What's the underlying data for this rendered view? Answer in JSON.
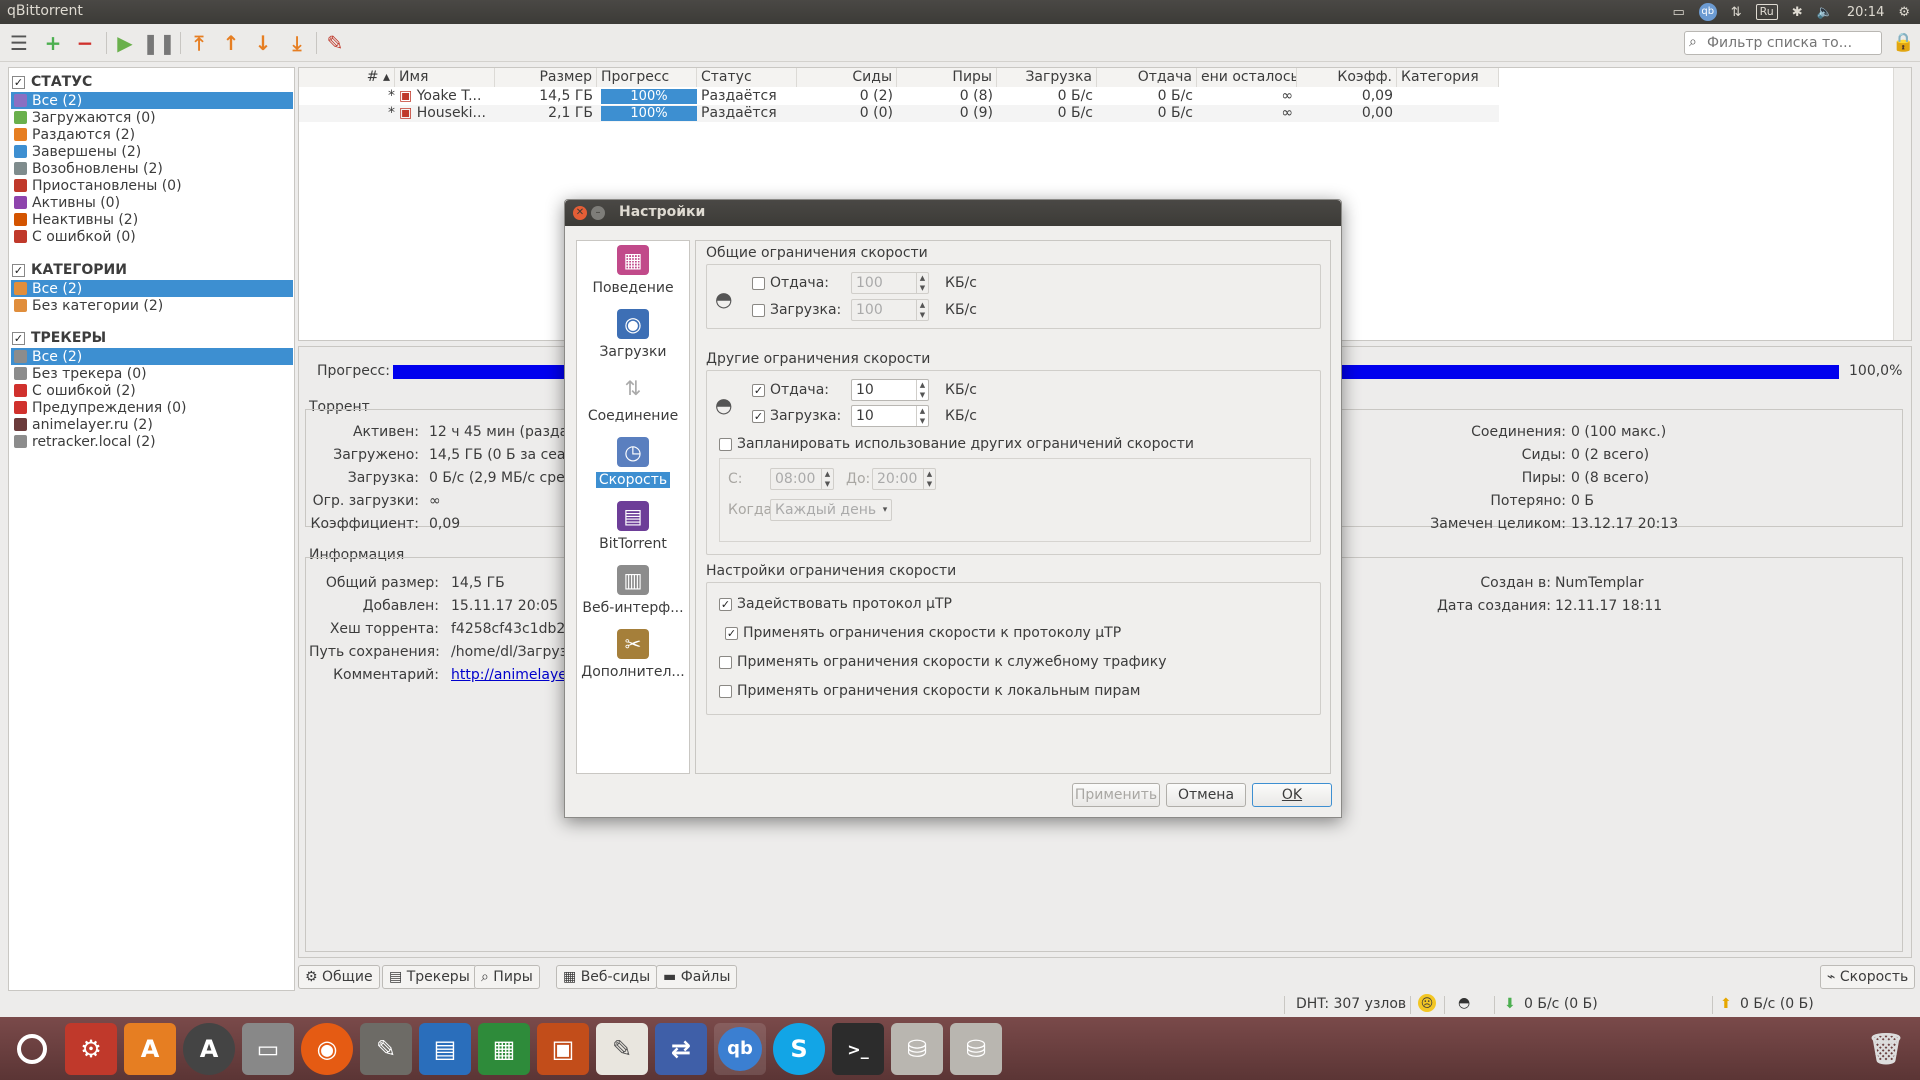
{
  "window": {
    "title": "qBittorrent"
  },
  "tray": {
    "lang": "Ru",
    "time": "20:14"
  },
  "toolbar": {
    "filter_placeholder": "Фильтр списка то..."
  },
  "sidebar": {
    "status": {
      "header": "СТАТУС",
      "items": [
        {
          "label": "Все (2)",
          "color": "#8a6fc2"
        },
        {
          "label": "Загружаются (0)",
          "color": "#6ab04c"
        },
        {
          "label": "Раздаются (2)",
          "color": "#e67e22"
        },
        {
          "label": "Завершены (2)",
          "color": "#3d8fd1"
        },
        {
          "label": "Возобновлены (2)",
          "color": "#7f8c8d"
        },
        {
          "label": "Приостановлены (0)",
          "color": "#c0392b"
        },
        {
          "label": "Активны (0)",
          "color": "#8e44ad"
        },
        {
          "label": "Неактивны (2)",
          "color": "#d35400"
        },
        {
          "label": "С ошибкой (0)",
          "color": "#c0392b"
        }
      ]
    },
    "categories": {
      "header": "КАТЕГОРИИ",
      "items": [
        {
          "label": "Все (2)",
          "color": "#e08e3c"
        },
        {
          "label": "Без категории (2)",
          "color": "#e08e3c"
        }
      ]
    },
    "trackers": {
      "header": "ТРЕКЕРЫ",
      "items": [
        {
          "label": "Все (2)",
          "color": "#8c8c8c"
        },
        {
          "label": "Без трекера (0)",
          "color": "#8c8c8c"
        },
        {
          "label": "С ошибкой (2)",
          "color": "#d0312d"
        },
        {
          "label": "Предупреждения (0)",
          "color": "#d0312d"
        },
        {
          "label": "animelayer.ru (2)",
          "color": "#6b3b3b"
        },
        {
          "label": "retracker.local (2)",
          "color": "#8c8c8c"
        }
      ]
    }
  },
  "table": {
    "headers": {
      "num": "#",
      "name": "Имя",
      "size": "Размер",
      "progress": "Прогресс",
      "status": "Статус",
      "seeds": "Сиды",
      "peers": "Пиры",
      "down": "Загрузка",
      "up": "Отдача",
      "eta": "ени осталось",
      "ratio": "Коэфф.",
      "category": "Категория"
    },
    "rows": [
      {
        "num": "*",
        "name": "Yoake T...",
        "size": "14,5 ГБ",
        "progress": "100%",
        "status": "Раздаётся",
        "seeds": "0 (2)",
        "peers": "0 (8)",
        "down": "0 Б/с",
        "up": "0 Б/с",
        "eta": "∞",
        "ratio": "0,09",
        "category": ""
      },
      {
        "num": "*",
        "name": "Houseki...",
        "size": "2,1 ГБ",
        "progress": "100%",
        "status": "Раздаётся",
        "seeds": "0 (0)",
        "peers": "0 (9)",
        "down": "0 Б/с",
        "up": "0 Б/с",
        "eta": "∞",
        "ratio": "0,00",
        "category": ""
      }
    ]
  },
  "details": {
    "progress_label": "Прогресс:",
    "progress_value": "100,0%",
    "progress_fraction": 1.0,
    "torrent_section": "Торрент",
    "active_label": "Активен:",
    "active_value": "12 ч 45 мин (раздаё",
    "downloaded_label": "Загружено:",
    "downloaded_value": "14,5 ГБ (0 Б за сеанс",
    "download_label": "Загрузка:",
    "download_value": "0 Б/с (2,9 МБ/с сред",
    "dl_limit_label": "Огр. загрузки:",
    "dl_limit_value": "∞",
    "ratio_label": "Коэффициент:",
    "ratio_value": "0,09",
    "connections_label": "Соединения:",
    "connections_value": "0 (100 макс.)",
    "seeds_label": "Сиды:",
    "seeds_value": "0 (2 всего)",
    "peers_label": "Пиры:",
    "peers_value": "0 (8 всего)",
    "wasted_label": "Потеряно:",
    "wasted_value": "0 Б",
    "complete_label": "Замечен целиком:",
    "complete_value": "13.12.17 20:13",
    "info_section": "Информация",
    "total_size_label": "Общий размер:",
    "total_size_value": "14,5 ГБ",
    "added_label": "Добавлен:",
    "added_value": "15.11.17 20:05",
    "hash_label": "Хеш торрента:",
    "hash_value": "f4258cf43c1db2",
    "save_path_label": "Путь сохранения:",
    "save_path_value": "/home/dl/Загруз",
    "comment_label": "Комментарий:",
    "comment_value": "http://animelaye",
    "created_by_label": "Создан в:",
    "created_by_value": "NumTemplar",
    "created_on_label": "Дата создания:",
    "created_on_value": "12.11.17 18:11"
  },
  "tabs": [
    "Общие",
    "Трекеры",
    "Пиры",
    "Веб-сиды",
    "Файлы"
  ],
  "speed_tab": "Скорость",
  "statusbar": {
    "dht": "DHT: 307 узлов",
    "down": "0 Б/с (0 Б)",
    "up": "0 Б/с (0 Б)"
  },
  "dialog": {
    "title": "Настройки",
    "nav": [
      {
        "label": "Поведение",
        "icon": "behavior-icon"
      },
      {
        "label": "Загрузки",
        "icon": "downloads-icon"
      },
      {
        "label": "Соединение",
        "icon": "connection-icon"
      },
      {
        "label": "Скорость",
        "icon": "speed-icon"
      },
      {
        "label": "BitTorrent",
        "icon": "bittorrent-icon"
      },
      {
        "label": "Веб-интерф...",
        "icon": "webui-icon"
      },
      {
        "label": "Дополнител...",
        "icon": "advanced-icon"
      }
    ],
    "global_limits": {
      "title": "Общие ограничения скорости",
      "upload_label": "Отдача:",
      "upload_value": "100",
      "upload_checked": false,
      "download_label": "Загрузка:",
      "download_value": "100",
      "download_checked": false,
      "unit": "КБ/с"
    },
    "alt_limits": {
      "title": "Другие ограничения скорости",
      "upload_label": "Отдача:",
      "upload_value": "10",
      "upload_checked": true,
      "download_label": "Загрузка:",
      "download_value": "10",
      "download_checked": true,
      "unit": "КБ/с",
      "schedule_label": "Запланировать использование других ограничений скорости",
      "schedule_checked": false,
      "from_label": "С:",
      "from_value": "08:00",
      "to_label": "До:",
      "to_value": "20:00",
      "when_label": "Когда:",
      "when_value": "Каждый день"
    },
    "limit_settings": {
      "title": "Настройки ограничения скорости",
      "options": [
        {
          "label": "Задействовать протокол µTP",
          "checked": true
        },
        {
          "label": "Применять ограничения скорости к протоколу µTP",
          "checked": true
        },
        {
          "label": "Применять ограничения скорости к служебному трафику",
          "checked": false
        },
        {
          "label": "Применять ограничения скорости к локальным пирам",
          "checked": false
        }
      ]
    },
    "buttons": {
      "apply": "Применить",
      "cancel": "Отмена",
      "ok": "OK"
    }
  },
  "colors": {
    "accent": "#3d8fd1",
    "progress_fill": "#0000ee",
    "launcher_bg": "#6a3f3f"
  }
}
